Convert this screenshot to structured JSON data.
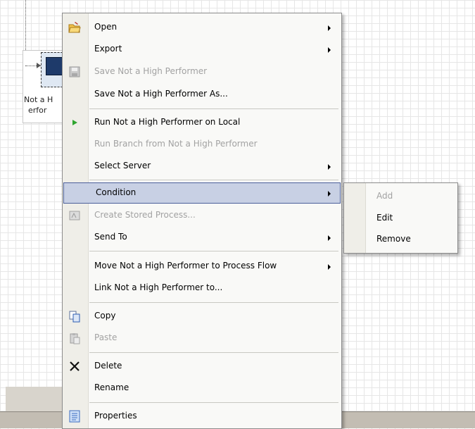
{
  "node": {
    "label_line1": "Not a H",
    "label_line2": "erfor"
  },
  "menu": {
    "open": {
      "label": "Open",
      "icon": "open-folder-icon"
    },
    "export": {
      "label": "Export"
    },
    "save": {
      "label": "Save Not a High Performer",
      "icon": "save-disk-icon"
    },
    "save_as": {
      "label": "Save Not a High Performer As..."
    },
    "run": {
      "label": "Run Not a High Performer on Local",
      "icon": "run-play-icon"
    },
    "run_branch": {
      "label": "Run Branch from Not a High Performer"
    },
    "select_server": {
      "label": "Select Server"
    },
    "condition": {
      "label": "Condition"
    },
    "create_stored": {
      "label": "Create Stored Process...",
      "icon": "stored-process-icon"
    },
    "send_to": {
      "label": "Send To"
    },
    "move": {
      "label": "Move Not a High Performer to Process Flow"
    },
    "link": {
      "label": "Link Not a High Performer to..."
    },
    "copy": {
      "label": "Copy",
      "icon": "copy-icon"
    },
    "paste": {
      "label": "Paste",
      "icon": "paste-icon"
    },
    "delete": {
      "label": "Delete",
      "icon": "delete-x-icon"
    },
    "rename": {
      "label": "Rename"
    },
    "properties": {
      "label": "Properties",
      "icon": "properties-icon"
    }
  },
  "submenu": {
    "add": {
      "label": "Add"
    },
    "edit": {
      "label": "Edit"
    },
    "remove": {
      "label": "Remove"
    }
  },
  "colors": {
    "highlight_bg": "#c8d0e4",
    "highlight_border": "#4b5f9a",
    "disabled_text": "#a2a2a2",
    "run_green": "#2fa52f"
  }
}
